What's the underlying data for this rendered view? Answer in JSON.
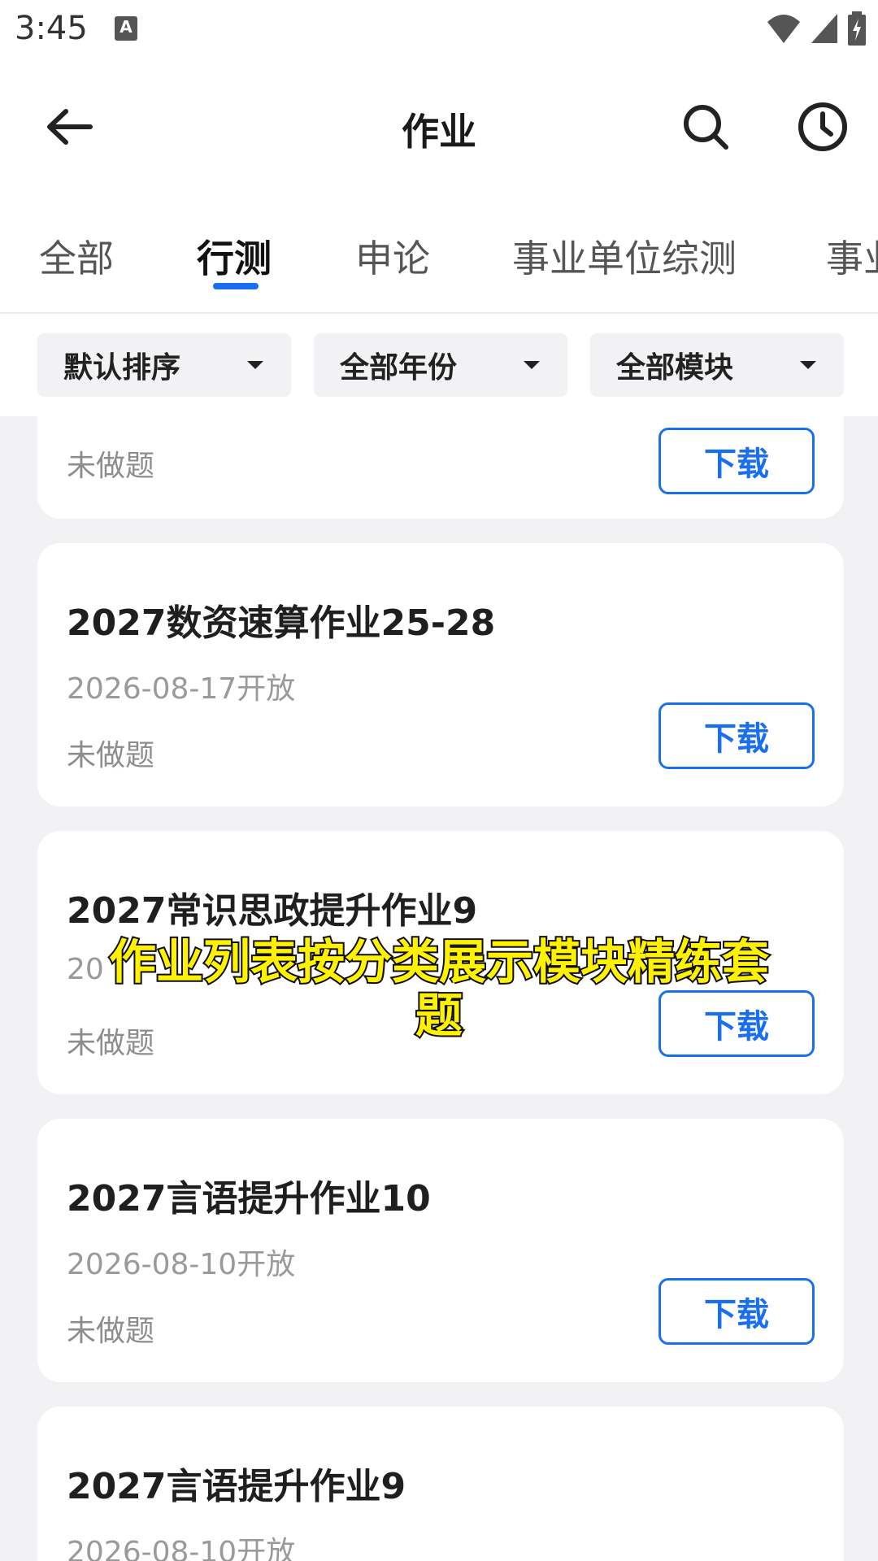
{
  "status_bar": {
    "time": "3:45",
    "notification_badge": "A"
  },
  "header": {
    "title": "作业"
  },
  "tabs": [
    {
      "label": "全部",
      "active": false
    },
    {
      "label": "行测",
      "active": true
    },
    {
      "label": "申论",
      "active": false
    },
    {
      "label": "事业单位综测",
      "active": false
    },
    {
      "label": "事业",
      "active": false
    }
  ],
  "filters": [
    {
      "label": "默认排序"
    },
    {
      "label": "全部年份"
    },
    {
      "label": "全部模块"
    }
  ],
  "list": [
    {
      "title": "",
      "date": "",
      "status": "未做题",
      "button": "下载"
    },
    {
      "title": "2027数资速算作业25-28",
      "date": "2026-08-17开放",
      "status": "未做题",
      "button": "下载"
    },
    {
      "title": "2027常识思政提升作业9",
      "date": "20",
      "status": "未做题",
      "button": "下载"
    },
    {
      "title": "2027言语提升作业10",
      "date": "2026-08-10开放",
      "status": "未做题",
      "button": "下载"
    },
    {
      "title": "2027言语提升作业9",
      "date": "2026-08-10开放",
      "status": "",
      "button": ""
    }
  ],
  "caption": {
    "line1": "作业列表按分类展示模块精练套",
    "line2": "题"
  },
  "colors": {
    "accent": "#1a6ff0",
    "caption_text": "#fff200"
  }
}
